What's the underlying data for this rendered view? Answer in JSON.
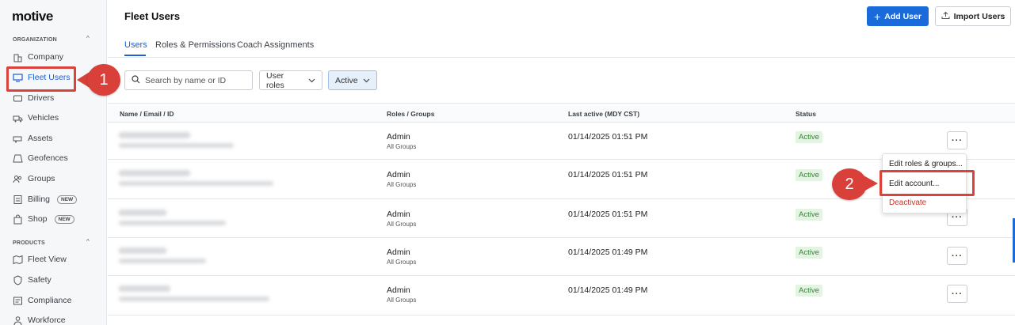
{
  "app": {
    "logo": "motive"
  },
  "sidebar": {
    "organization_label": "ORGANIZATION",
    "products_label": "PRODUCTS",
    "org_items": [
      {
        "label": "Company",
        "icon": "building-icon"
      },
      {
        "label": "Fleet Users",
        "icon": "monitor-icon"
      },
      {
        "label": "Drivers",
        "icon": "steering-icon"
      },
      {
        "label": "Vehicles",
        "icon": "truck-icon"
      },
      {
        "label": "Assets",
        "icon": "trailer-icon"
      },
      {
        "label": "Geofences",
        "icon": "geofence-icon"
      },
      {
        "label": "Groups",
        "icon": "groups-icon"
      },
      {
        "label": "Billing",
        "icon": "billing-icon",
        "badge": "NEW"
      },
      {
        "label": "Shop",
        "icon": "shop-icon",
        "badge": "NEW"
      }
    ],
    "product_items": [
      {
        "label": "Fleet View",
        "icon": "map-icon"
      },
      {
        "label": "Safety",
        "icon": "shield-icon"
      },
      {
        "label": "Compliance",
        "icon": "compliance-icon"
      },
      {
        "label": "Workforce",
        "icon": "person-icon"
      }
    ]
  },
  "header": {
    "title": "Fleet Users",
    "add_user_label": "Add User",
    "import_users_label": "Import Users"
  },
  "tabs": [
    {
      "label": "Users"
    },
    {
      "label": "Roles & Permissions"
    },
    {
      "label": "Coach Assignments"
    }
  ],
  "filters": {
    "search_placeholder": "Search by name or ID",
    "roles_label": "User roles",
    "status_label": "Active"
  },
  "table": {
    "columns": [
      "Name / Email / ID",
      "Roles / Groups",
      "Last active (MDY CST)",
      "Status"
    ],
    "rows": [
      {
        "role": "Admin",
        "groups": "All Groups",
        "last_active": "01/14/2025 01:51 PM",
        "status": "Active"
      },
      {
        "role": "Admin",
        "groups": "All Groups",
        "last_active": "01/14/2025 01:51 PM",
        "status": "Active"
      },
      {
        "role": "Admin",
        "groups": "All Groups",
        "last_active": "01/14/2025 01:51 PM",
        "status": "Active"
      },
      {
        "role": "Admin",
        "groups": "All Groups",
        "last_active": "01/14/2025 01:49 PM",
        "status": "Active"
      },
      {
        "role": "Admin",
        "groups": "All Groups",
        "last_active": "01/14/2025 01:49 PM",
        "status": "Active"
      }
    ],
    "kebab_label": "···"
  },
  "menu": {
    "edit_roles": "Edit roles & groups...",
    "edit_account": "Edit account...",
    "deactivate": "Deactivate"
  },
  "callouts": {
    "one": "1",
    "two": "2"
  },
  "colors": {
    "accent": "#1a6ad9",
    "callout": "#d9403a",
    "status_green": "#2c8a2c"
  }
}
